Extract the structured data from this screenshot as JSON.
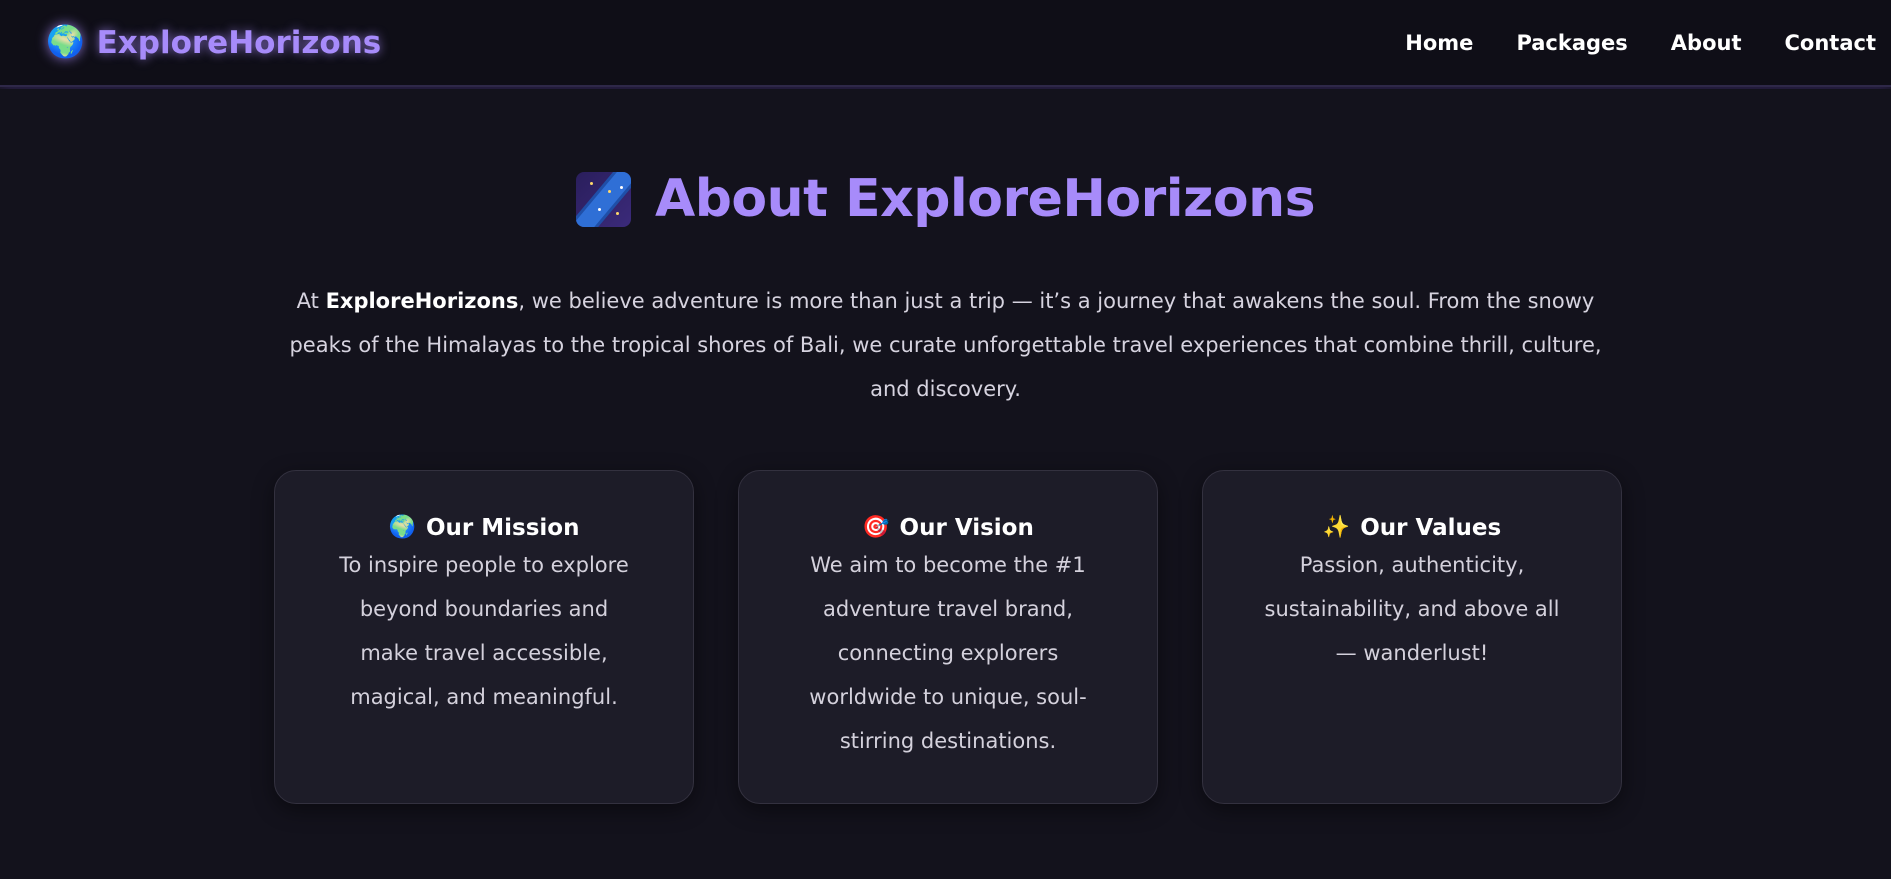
{
  "nav": {
    "brand_icon": "globe-icon",
    "brand_icon_glyph": "🌍",
    "brand_name": "ExploreHorizons",
    "links": [
      "Home",
      "Packages",
      "About",
      "Contact"
    ]
  },
  "about": {
    "title_icon": "milky-way-icon",
    "title": "About ExploreHorizons",
    "intro_prefix": "At ",
    "intro_brand": "ExploreHorizons",
    "intro_rest": ", we believe adventure is more than just a trip — it’s a journey that awakens the soul. From the snowy peaks of the Himalayas to the tropical shores of Bali, we curate unforgettable travel experiences that combine thrill, culture, and discovery."
  },
  "cards": [
    {
      "icon": "globe-icon",
      "icon_glyph": "🌍",
      "title": "Our Mission",
      "text": "To inspire people to explore beyond boundaries and make travel accessible, magical, and meaningful."
    },
    {
      "icon": "target-icon",
      "icon_glyph": "🎯",
      "title": "Our Vision",
      "text": "We aim to become the #1 adventure travel brand, connecting explorers worldwide to unique, soul-stirring destinations."
    },
    {
      "icon": "sparkles-icon",
      "icon_glyph": "✨",
      "title": "Our Values",
      "text": "Passion, authenticity, sustainability, and above all — wanderlust!"
    }
  ],
  "colors": {
    "accent": "#a78bfa",
    "background": "#13121c",
    "card": "#1d1c28"
  }
}
